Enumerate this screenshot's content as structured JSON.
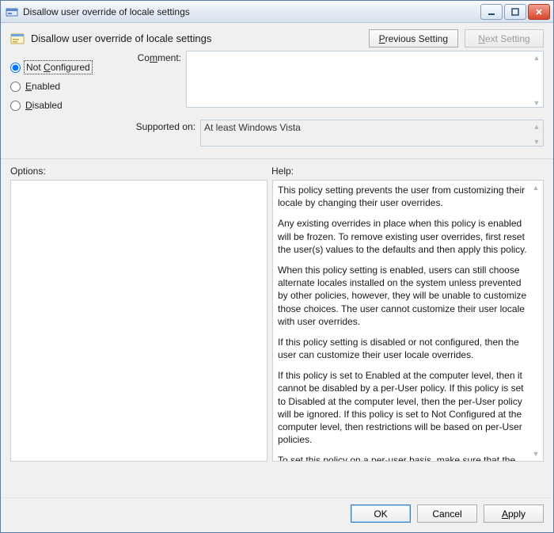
{
  "window": {
    "title": "Disallow user override of locale settings"
  },
  "heading": {
    "title": "Disallow user override of locale settings"
  },
  "nav": {
    "previous_html": "<u>P</u>revious Setting",
    "next_html": "<u>N</u>ext Setting"
  },
  "radios": {
    "not_configured_html": "Not <u>C</u>onfigured",
    "enabled_html": "<u>E</u>nabled",
    "disabled_html": "<u>D</u>isabled",
    "selected": "not_configured"
  },
  "labels": {
    "comment_html": "Co<u>m</u>ment:",
    "supported": "Supported on:",
    "options": "Options:",
    "help": "Help:"
  },
  "comment": {
    "value": ""
  },
  "supported": {
    "value": "At least Windows Vista"
  },
  "help": {
    "p1": "This policy setting prevents the user from customizing their locale by changing their user overrides.",
    "p2": "Any existing overrides in place when this policy is enabled will be frozen. To remove existing user overrides, first reset the user(s) values to the defaults and then apply this policy.",
    "p3": "When this policy setting is enabled, users can still choose alternate locales installed on the system unless prevented by other policies, however, they will be unable to customize those choices.  The user cannot customize their user locale with user overrides.",
    "p4": "If this policy setting is disabled or not configured, then the user can customize their user locale overrides.",
    "p5": "If this policy is set to Enabled at the computer level, then it cannot be disabled by a per-User policy. If this policy is set to Disabled at the computer level, then the per-User policy will be ignored. If this policy is set to Not Configured at the computer level, then restrictions will be based on per-User policies.",
    "p6": "To set this policy on a per-user basis, make sure that the per-computer policy is set to Not Configured."
  },
  "buttons": {
    "ok": "OK",
    "cancel": "Cancel",
    "apply_html": "<u>A</u>pply"
  }
}
